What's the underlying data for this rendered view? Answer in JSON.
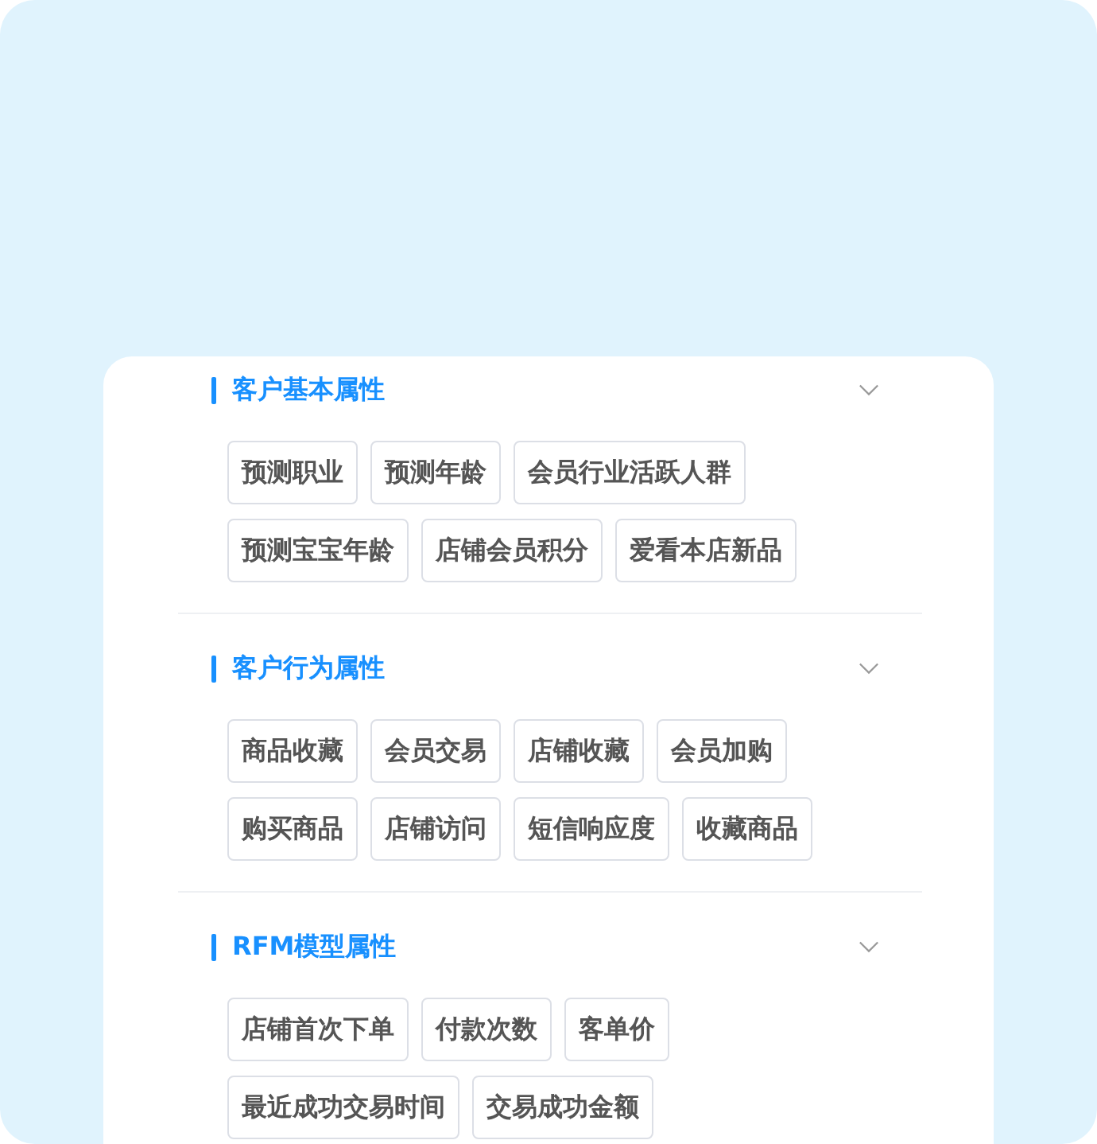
{
  "sections": [
    {
      "title": "客户基本属性",
      "tags": [
        "预测职业",
        "预测年龄",
        "会员行业活跃人群",
        "预测宝宝年龄",
        "店铺会员积分",
        "爱看本店新品"
      ]
    },
    {
      "title": "客户行为属性",
      "tags": [
        "商品收藏",
        "会员交易",
        "店铺收藏",
        "会员加购",
        "购买商品",
        "店铺访问",
        "短信响应度",
        "收藏商品"
      ]
    },
    {
      "title": "RFM模型属性",
      "tags": [
        "店铺首次下单",
        "付款次数",
        "客单价",
        "最近成功交易时间",
        "交易成功金额"
      ]
    }
  ]
}
